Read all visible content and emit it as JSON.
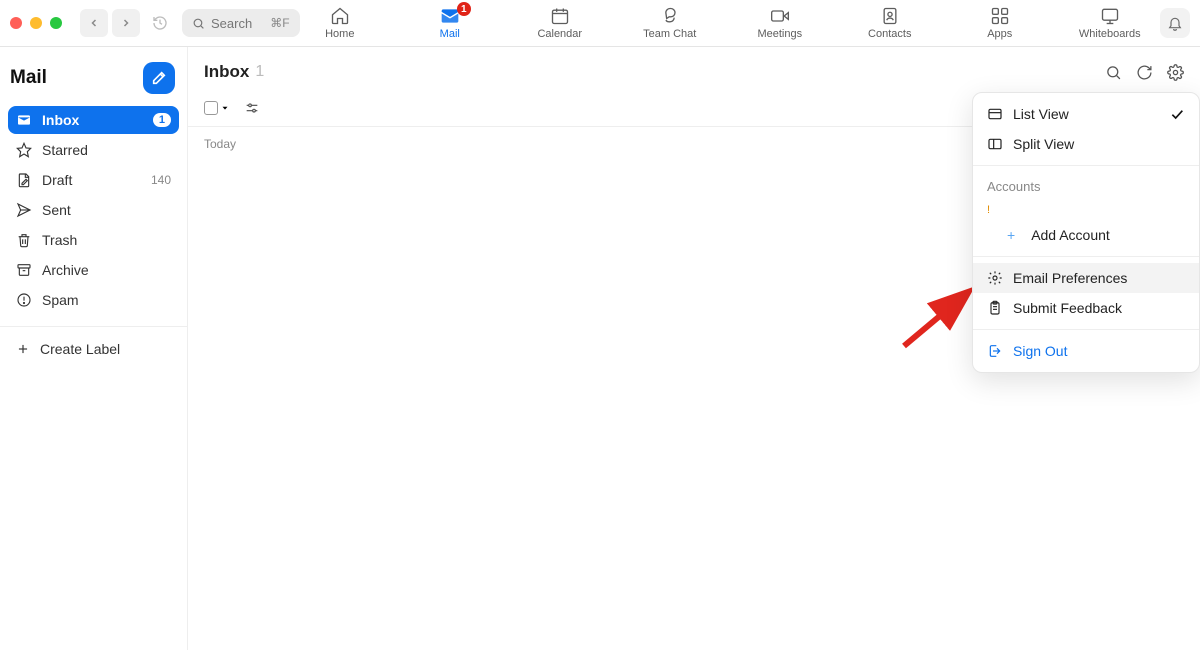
{
  "window": {
    "traffic": {
      "close": "#ff5f57",
      "min": "#febc2e",
      "max": "#28c840"
    }
  },
  "search": {
    "placeholder": "Search",
    "shortcut": "⌘F"
  },
  "topnav": {
    "items": [
      {
        "label": "Home"
      },
      {
        "label": "Mail",
        "badge": "1"
      },
      {
        "label": "Calendar"
      },
      {
        "label": "Team Chat"
      },
      {
        "label": "Meetings"
      },
      {
        "label": "Contacts"
      },
      {
        "label": "Apps"
      },
      {
        "label": "Whiteboards"
      }
    ]
  },
  "sidebar": {
    "title": "Mail",
    "folders": [
      {
        "label": "Inbox",
        "count": "1"
      },
      {
        "label": "Starred"
      },
      {
        "label": "Draft",
        "count": "140"
      },
      {
        "label": "Sent"
      },
      {
        "label": "Trash"
      },
      {
        "label": "Archive"
      },
      {
        "label": "Spam"
      }
    ],
    "create_label": "Create Label"
  },
  "content": {
    "title": "Inbox",
    "count": "1",
    "today": "Today"
  },
  "menu": {
    "list_view": "List View",
    "split_view": "Split View",
    "accounts": "Accounts",
    "add_account": "Add Account",
    "email_prefs": "Email Preferences",
    "submit_feedback": "Submit Feedback",
    "sign_out": "Sign Out"
  }
}
